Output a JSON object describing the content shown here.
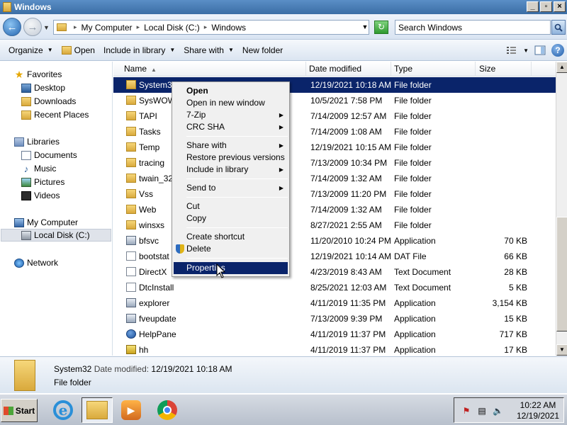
{
  "window": {
    "title": "Windows",
    "btn_min": "_",
    "btn_max": "▫",
    "btn_close": "×"
  },
  "address": {
    "crumbs": [
      "My Computer",
      "Local Disk (C:)",
      "Windows"
    ],
    "search_placeholder": "Search Windows"
  },
  "toolbar": {
    "organize": "Organize",
    "open": "Open",
    "include": "Include in library",
    "share": "Share with",
    "new_folder": "New folder"
  },
  "sidebar": {
    "favorites": "Favorites",
    "desktop": "Desktop",
    "downloads": "Downloads",
    "recent": "Recent Places",
    "libraries": "Libraries",
    "documents": "Documents",
    "music": "Music",
    "pictures": "Pictures",
    "videos": "Videos",
    "computer": "My Computer",
    "localdisk": "Local Disk (C:)",
    "network": "Network"
  },
  "columns": {
    "name": "Name",
    "date": "Date modified",
    "type": "Type",
    "size": "Size"
  },
  "rows": [
    {
      "name": "System32",
      "date": "12/19/2021 10:18 AM",
      "type": "File folder",
      "size": ""
    },
    {
      "name": "SysWOW",
      "date": "10/5/2021 7:58 PM",
      "type": "File folder",
      "size": ""
    },
    {
      "name": "TAPI",
      "date": "7/14/2009 12:57 AM",
      "type": "File folder",
      "size": ""
    },
    {
      "name": "Tasks",
      "date": "7/14/2009 1:08 AM",
      "type": "File folder",
      "size": ""
    },
    {
      "name": "Temp",
      "date": "12/19/2021 10:15 AM",
      "type": "File folder",
      "size": ""
    },
    {
      "name": "tracing",
      "date": "7/13/2009 10:34 PM",
      "type": "File folder",
      "size": ""
    },
    {
      "name": "twain_32",
      "date": "7/14/2009 1:32 AM",
      "type": "File folder",
      "size": ""
    },
    {
      "name": "Vss",
      "date": "7/13/2009 11:20 PM",
      "type": "File folder",
      "size": ""
    },
    {
      "name": "Web",
      "date": "7/14/2009 1:32 AM",
      "type": "File folder",
      "size": ""
    },
    {
      "name": "winsxs",
      "date": "8/27/2021 2:55 AM",
      "type": "File folder",
      "size": ""
    },
    {
      "name": "bfsvc",
      "date": "11/20/2010 10:24 PM",
      "type": "Application",
      "size": "70 KB"
    },
    {
      "name": "bootstat",
      "date": "12/19/2021 10:14 AM",
      "type": "DAT File",
      "size": "66 KB"
    },
    {
      "name": "DirectX",
      "date": "4/23/2019 8:43 AM",
      "type": "Text Document",
      "size": "28 KB"
    },
    {
      "name": "DtcInstall",
      "date": "8/25/2021 12:03 AM",
      "type": "Text Document",
      "size": "5 KB"
    },
    {
      "name": "explorer",
      "date": "4/11/2019 11:35 PM",
      "type": "Application",
      "size": "3,154 KB"
    },
    {
      "name": "fveupdate",
      "date": "7/13/2009 9:39 PM",
      "type": "Application",
      "size": "15 KB"
    },
    {
      "name": "HelpPane",
      "date": "4/11/2019 11:37 PM",
      "type": "Application",
      "size": "717 KB"
    },
    {
      "name": "hh",
      "date": "4/11/2019 11:37 PM",
      "type": "Application",
      "size": "17 KB"
    }
  ],
  "context_menu": {
    "open": "Open",
    "open_new": "Open in new window",
    "zip": "7-Zip",
    "crc": "CRC SHA",
    "share": "Share with",
    "restore": "Restore previous versions",
    "include": "Include in library",
    "send": "Send to",
    "cut": "Cut",
    "copy": "Copy",
    "shortcut": "Create shortcut",
    "delete": "Delete",
    "properties": "Properties"
  },
  "details": {
    "name": "System32",
    "date_label": "Date modified:",
    "date": "12/19/2021 10:18 AM",
    "type": "File folder"
  },
  "taskbar": {
    "start": "Start",
    "time": "10:22 AM",
    "date": "12/19/2021"
  },
  "colors": {
    "selection": "#0a246a",
    "folder": "#d9a93c"
  }
}
